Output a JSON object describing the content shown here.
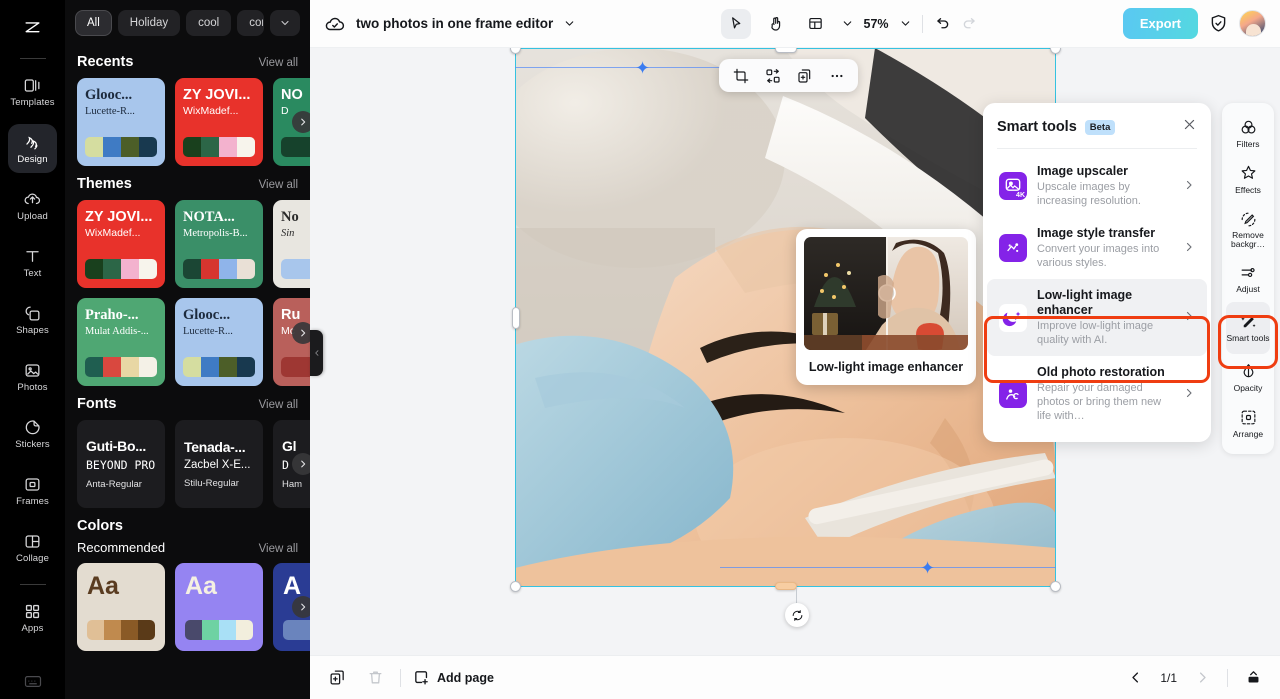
{
  "rail": {
    "logo": "capcut-logo",
    "items": [
      {
        "label": "Templates",
        "icon": "templates-icon",
        "active": false
      },
      {
        "label": "Design",
        "icon": "design-icon",
        "active": true
      },
      {
        "label": "Upload",
        "icon": "upload-icon",
        "active": false
      },
      {
        "label": "Text",
        "icon": "text-icon",
        "active": false
      },
      {
        "label": "Shapes",
        "icon": "shapes-icon",
        "active": false
      },
      {
        "label": "Photos",
        "icon": "photos-icon",
        "active": false
      },
      {
        "label": "Stickers",
        "icon": "stickers-icon",
        "active": false
      },
      {
        "label": "Frames",
        "icon": "frames-icon",
        "active": false
      },
      {
        "label": "Collage",
        "icon": "collage-icon",
        "active": false
      },
      {
        "label": "Apps",
        "icon": "apps-icon",
        "active": false
      }
    ]
  },
  "left_panel": {
    "chips": [
      {
        "label": "All",
        "active": true
      },
      {
        "label": "Holiday",
        "active": false
      },
      {
        "label": "cool",
        "active": false
      },
      {
        "label": "concise",
        "active": false
      }
    ],
    "chip_more_icon": "chevron-down-icon",
    "view_all": "View all",
    "sections": {
      "recents": {
        "title": "Recents",
        "cards": [
          {
            "t1": "Glooc...",
            "t2": "Lucette-R...",
            "bg": "#a8c6ec",
            "fg": "#1c2a3d",
            "swatches": [
              "#d5dda0",
              "#3f7bc4",
              "#4c5e28",
              "#18394f"
            ]
          },
          {
            "t1": "ZY JOVI...",
            "t2": "WixMadef...",
            "bg": "#e8322b",
            "fg": "#ffffff",
            "swatches": [
              "#19401d",
              "#2c6647",
              "#f3b2ce",
              "#f7f4ec"
            ]
          },
          {
            "t1": "NO",
            "t2": "D",
            "bg": "#2a8a60",
            "fg": "#ffffff",
            "swatches": [
              "#16422c",
              "#16422c",
              "#16422c",
              "#16422c"
            ]
          }
        ]
      },
      "themes": {
        "title": "Themes",
        "cards": [
          {
            "t1": "ZY JOVI...",
            "t2": "WixMadef...",
            "bg": "#e8322b",
            "fg": "#ffffff",
            "swatches": [
              "#19401d",
              "#2c6647",
              "#f3b2ce",
              "#f7f4ec"
            ]
          },
          {
            "t1": "NOTA...",
            "t2": "Metropolis-B...",
            "bg": "#3a8f68",
            "fg": "#ffffff",
            "serif": true,
            "swatches": [
              "#1b4634",
              "#d6352f",
              "#8fb4ea",
              "#e9e0d6"
            ]
          },
          {
            "t1": "No",
            "t2": "Sin",
            "bg": "#e8e6e0",
            "fg": "#2a2a2a",
            "serif": true,
            "swatches": [
              "#a8c6ec",
              "#a8c6ec",
              "#a8c6ec",
              "#a8c6ec"
            ]
          },
          {
            "t1": "Praho-...",
            "t2": "Mulat Addis-...",
            "bg": "#4fa773",
            "fg": "#ffffff",
            "serif": true,
            "swatches": [
              "#1f5e50",
              "#d9483f",
              "#e8d7a4",
              "#f4f1e7"
            ]
          },
          {
            "t1": "Glooc...",
            "t2": "Lucette-R...",
            "bg": "#a8c6ec",
            "fg": "#1c2a3d",
            "serif": true,
            "swatches": [
              "#d5dda0",
              "#3f7bc4",
              "#4c5e28",
              "#18394f"
            ]
          },
          {
            "t1": "Ru",
            "t2": "Mc",
            "bg": "#b9605b",
            "fg": "#ffffff",
            "swatches": [
              "#9e3733",
              "#9e3733",
              "#9e3733",
              "#9e3733"
            ]
          }
        ]
      },
      "fonts": {
        "title": "Fonts",
        "cards": [
          {
            "t1": "Guti-Bo...",
            "t2": "BEYOND PRO...",
            "t3": "Anta-Regular"
          },
          {
            "t1": "Tenada-...",
            "t2": "Zacbel X-E...",
            "t3": "Stilu-Regular"
          },
          {
            "t1": "Gl",
            "t2": "D",
            "t3": "Ham"
          }
        ]
      },
      "colors": {
        "title": "Colors",
        "subtitle": "Recommended",
        "cards": [
          {
            "aa": "Aa",
            "bg": "#e3dcd0",
            "fg": "#5a3c20",
            "swatches": [
              "#e0bf96",
              "#c08a4e",
              "#8a5a26",
              "#5a3a18"
            ]
          },
          {
            "aa": "Aa",
            "bg": "#9584f2",
            "fg": "#f5f0e2",
            "swatches": [
              "#49496b",
              "#6ed2a3",
              "#a9e0f6",
              "#f2eedd"
            ]
          },
          {
            "aa": "A",
            "bg": "#2a3c94",
            "fg": "#ffffff",
            "swatches": [
              "#6a84bd",
              "#6a84bd",
              "#6a84bd",
              "#6a84bd"
            ]
          }
        ]
      }
    },
    "collapse_icon": "chevron-left-icon",
    "next_arrow_icon": "chevron-right-icon"
  },
  "topbar": {
    "cloud_icon": "cloud-saved-icon",
    "title": "two photos in one frame editor",
    "title_caret_icon": "chevron-down-icon",
    "select_tool_icon": "cursor-select-icon",
    "hand_tool_icon": "hand-pan-icon",
    "layout_tool_icon": "layout-grid-icon",
    "layout_caret_icon": "chevron-down-icon",
    "zoom": "57%",
    "zoom_caret_icon": "chevron-down-icon",
    "undo_icon": "undo-icon",
    "redo_icon": "redo-icon",
    "export_label": "Export",
    "shield_icon": "shield-check-icon",
    "avatar": "user-avatar"
  },
  "float_toolbar": {
    "crop_icon": "crop-icon",
    "replace_icon": "replace-image-icon",
    "duplicate_icon": "duplicate-icon",
    "more_icon": "more-options-icon"
  },
  "canvas": {
    "selection_rotate_icon": "rotate-icon",
    "sparkle_icon": "sparkle-icon"
  },
  "preview_card": {
    "label": "Low-light image enhancer"
  },
  "smart_tools": {
    "title": "Smart tools",
    "badge": "Beta",
    "close_icon": "close-icon",
    "chevron_icon": "chevron-right-icon",
    "highlight_color": "#ef3d11",
    "items": [
      {
        "name": "Image upscaler",
        "desc": "Upscale images by increasing resolution.",
        "icon": "upscaler-4k-icon",
        "highlighted": false
      },
      {
        "name": "Image style transfer",
        "desc": "Convert your images into various styles.",
        "icon": "style-transfer-icon",
        "highlighted": false
      },
      {
        "name": "Low-light image enhancer",
        "desc": "Improve low-light image quality with AI.",
        "icon": "moon-stars-icon",
        "highlighted": true
      },
      {
        "name": "Old photo restoration",
        "desc": "Repair your damaged photos or bring them new life with…",
        "icon": "photo-restore-icon",
        "highlighted": false
      }
    ]
  },
  "right_tools": {
    "items": [
      {
        "label": "Filters",
        "icon": "filters-icon",
        "selected": false
      },
      {
        "label": "Effects",
        "icon": "effects-icon",
        "selected": false
      },
      {
        "label": "Remove backgr…",
        "icon": "remove-background-icon",
        "selected": false
      },
      {
        "label": "Adjust",
        "icon": "adjust-icon",
        "selected": false
      },
      {
        "label": "Smart tools",
        "icon": "smart-tools-icon",
        "selected": true
      },
      {
        "label": "Opacity",
        "icon": "opacity-icon",
        "selected": false
      },
      {
        "label": "Arrange",
        "icon": "arrange-icon",
        "selected": false
      }
    ]
  },
  "bottombar": {
    "duplicate_page_icon": "duplicate-page-icon",
    "delete_page_icon": "delete-page-icon",
    "add_page_icon": "add-page-icon",
    "add_page_label": "Add page",
    "prev_icon": "chevron-left-icon",
    "page_indicator": "1/1",
    "next_icon": "chevron-right-icon",
    "expand_icon": "expand-panel-icon"
  }
}
